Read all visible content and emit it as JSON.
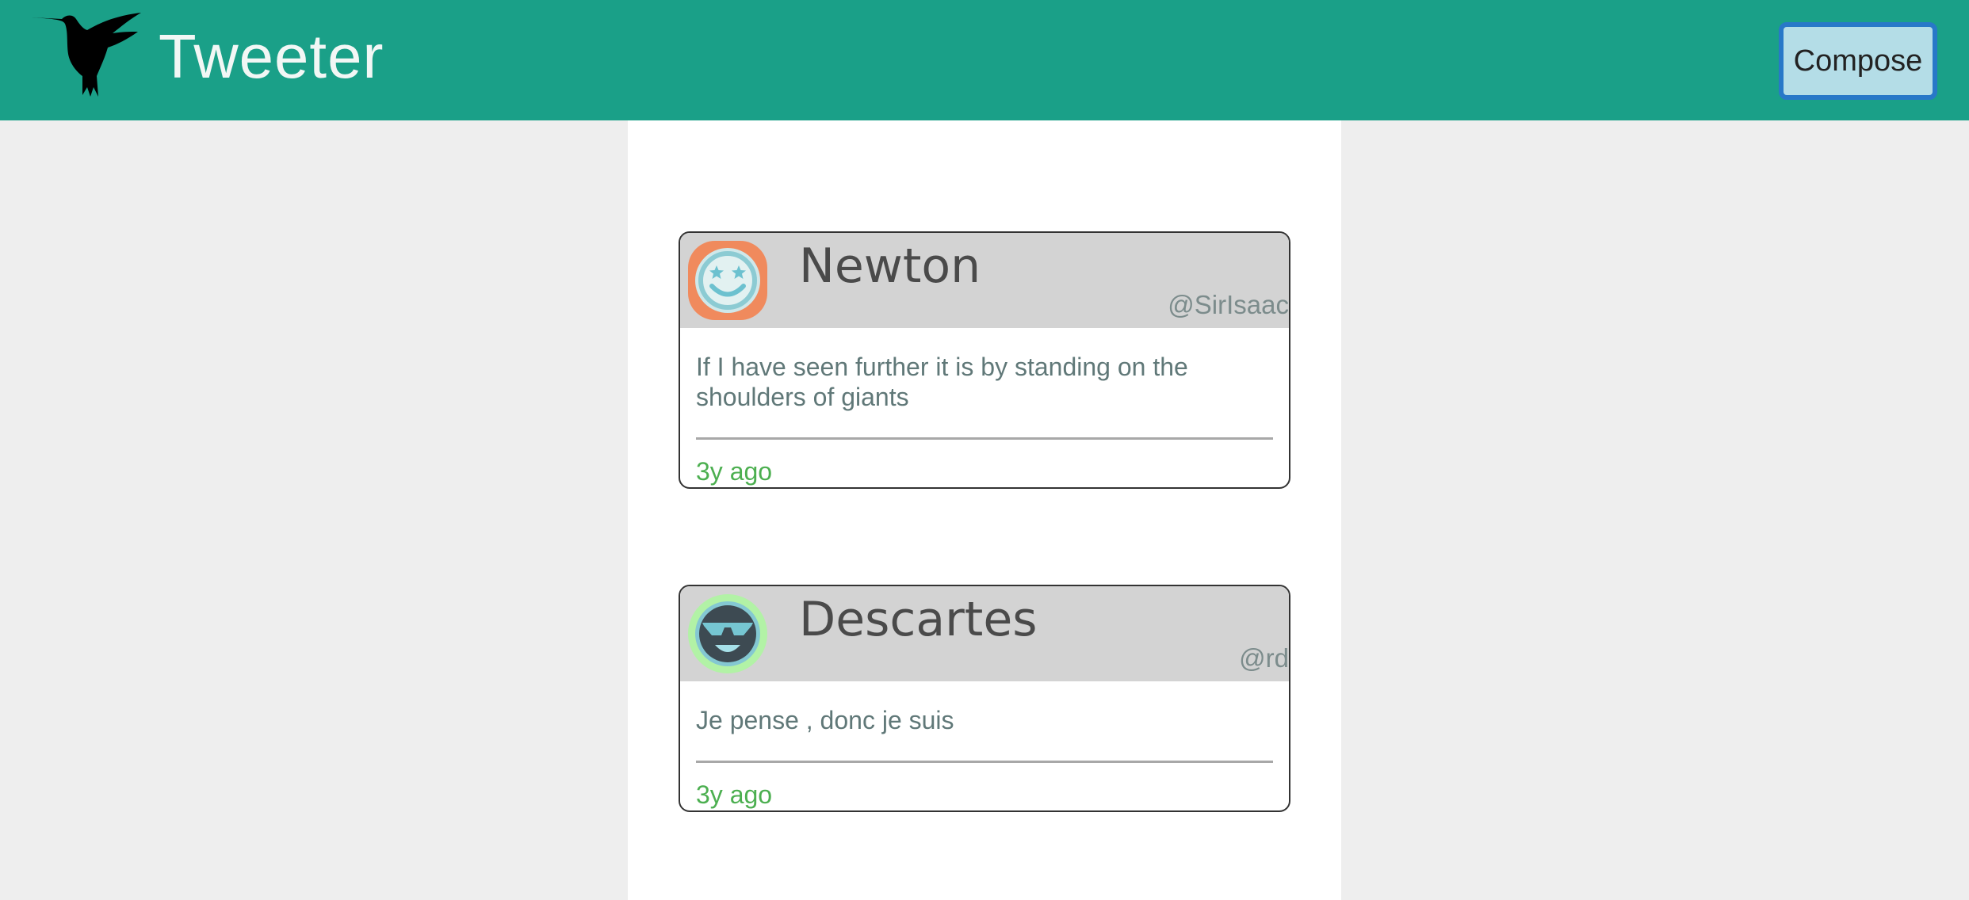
{
  "app": {
    "brand": "Tweeter",
    "logo_icon": "hummingbird-icon",
    "compose_label": "Compose",
    "colors": {
      "navbar": "#1aa088",
      "compose_bg": "#b4dde7",
      "compose_border": "#2878c8",
      "timestamp": "#4caf50"
    }
  },
  "tweets": [
    {
      "name": "Newton",
      "handle": "@SirIsaac",
      "text": "If I have seen further it is by standing on the shoulders of giants",
      "time": "3y ago",
      "avatar_icon": "star-eyes-smiley-icon"
    },
    {
      "name": "Descartes",
      "handle": "@rd",
      "text": "Je pense , donc je suis",
      "time": "3y ago",
      "avatar_icon": "sunglasses-smiley-icon"
    }
  ]
}
